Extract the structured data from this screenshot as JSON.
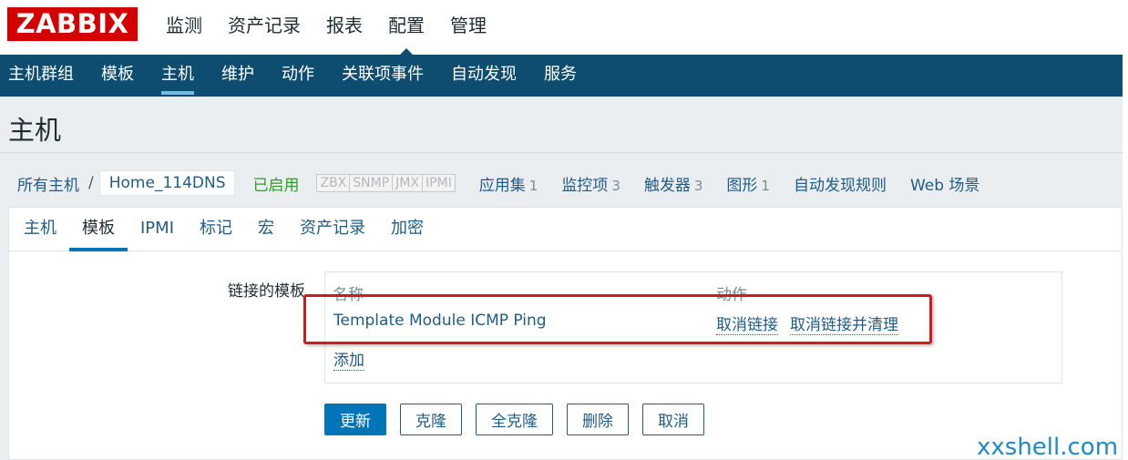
{
  "logo": "ZABBIX",
  "main_menu": [
    "监测",
    "资产记录",
    "报表",
    "配置",
    "管理"
  ],
  "sub_menu": [
    "主机群组",
    "模板",
    "主机",
    "维护",
    "动作",
    "关联项事件",
    "自动发现",
    "服务"
  ],
  "page_title": "主机",
  "host_nav": {
    "all_hosts": "所有主机",
    "separator": "/",
    "host_name": "Home_114DNS",
    "status": "已启用",
    "availability": [
      "ZBX",
      "SNMP",
      "JMX",
      "IPMI"
    ],
    "links": [
      {
        "label": "应用集",
        "count": "1"
      },
      {
        "label": "监控项",
        "count": "3"
      },
      {
        "label": "触发器",
        "count": "3"
      },
      {
        "label": "图形",
        "count": "1"
      },
      {
        "label": "自动发现规则",
        "count": ""
      },
      {
        "label": "Web 场景",
        "count": ""
      }
    ]
  },
  "tabs": [
    "主机",
    "模板",
    "IPMI",
    "标记",
    "宏",
    "资产记录",
    "加密"
  ],
  "form": {
    "linked_templates_label": "链接的模板",
    "col_name": "名称",
    "col_action": "动作",
    "template_name": "Template Module ICMP Ping",
    "unlink": "取消链接",
    "unlink_clear": "取消链接并清理",
    "add": "添加"
  },
  "buttons": {
    "update": "更新",
    "clone": "克隆",
    "full_clone": "全克隆",
    "delete": "删除",
    "cancel": "取消"
  },
  "watermark": "xxshell.com",
  "colors": {
    "brand_red": "#d40000",
    "nav_blue": "#0e4d6f",
    "link_blue": "#1f5c87",
    "enabled_green": "#2e9c2e",
    "highlight_red": "#d51818"
  }
}
